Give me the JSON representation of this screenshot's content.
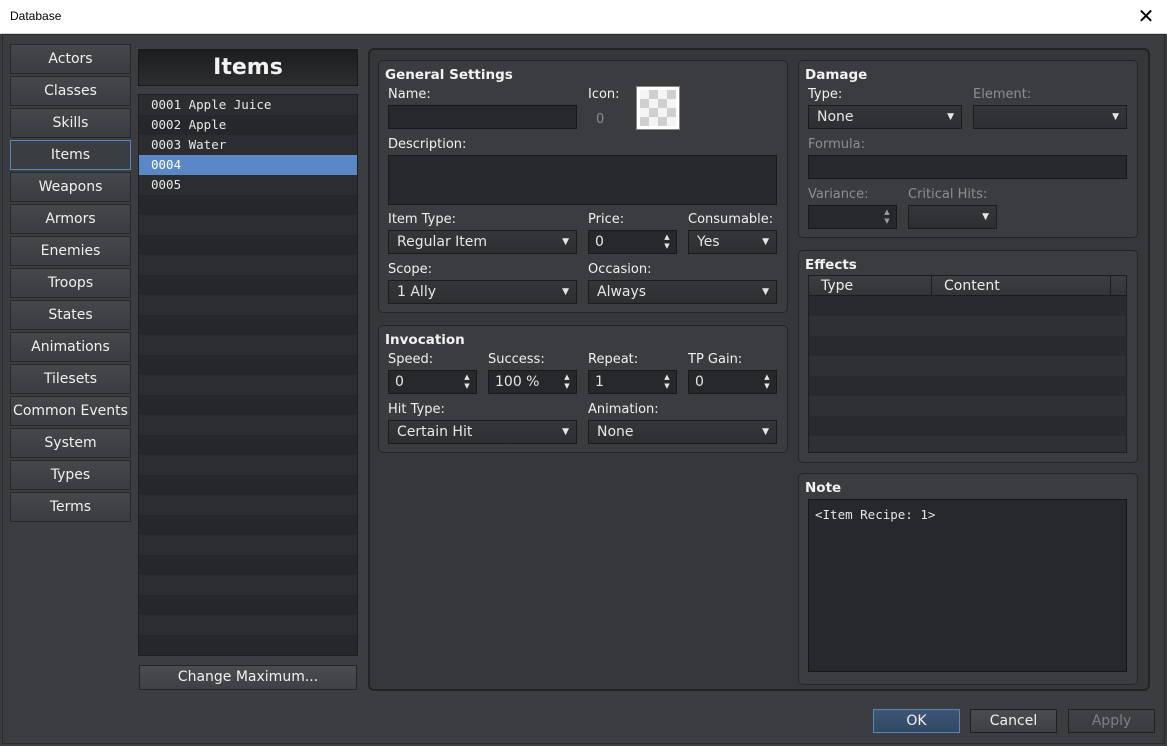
{
  "window": {
    "title": "Database",
    "close_glyph": "✕"
  },
  "categories": [
    "Actors",
    "Classes",
    "Skills",
    "Items",
    "Weapons",
    "Armors",
    "Enemies",
    "Troops",
    "States",
    "Animations",
    "Tilesets",
    "Common Events",
    "System",
    "Types",
    "Terms"
  ],
  "active_category": "Items",
  "items_panel": {
    "title": "Items",
    "rows": [
      "0001 Apple Juice",
      "0002 Apple",
      "0003 Water",
      "0004",
      "0005"
    ],
    "selected_index": 3,
    "change_maximum_label": "Change Maximum..."
  },
  "general": {
    "title": "General Settings",
    "name_label": "Name:",
    "name_value": "",
    "icon_label": "Icon:",
    "icon_index": "0",
    "description_label": "Description:",
    "description_value": "",
    "item_type_label": "Item Type:",
    "item_type_value": "Regular Item",
    "price_label": "Price:",
    "price_value": "0",
    "consumable_label": "Consumable:",
    "consumable_value": "Yes",
    "scope_label": "Scope:",
    "scope_value": "1 Ally",
    "occasion_label": "Occasion:",
    "occasion_value": "Always"
  },
  "invocation": {
    "title": "Invocation",
    "speed_label": "Speed:",
    "speed_value": "0",
    "success_label": "Success:",
    "success_value": "100 %",
    "repeat_label": "Repeat:",
    "repeat_value": "1",
    "tp_gain_label": "TP Gain:",
    "tp_gain_value": "0",
    "hit_type_label": "Hit Type:",
    "hit_type_value": "Certain Hit",
    "animation_label": "Animation:",
    "animation_value": "None"
  },
  "damage": {
    "title": "Damage",
    "type_label": "Type:",
    "type_value": "None",
    "element_label": "Element:",
    "element_value": "",
    "formula_label": "Formula:",
    "formula_value": "",
    "variance_label": "Variance:",
    "variance_value": "",
    "critical_label": "Critical Hits:",
    "critical_value": ""
  },
  "effects": {
    "title": "Effects",
    "col_type": "Type",
    "col_content": "Content"
  },
  "note": {
    "title": "Note",
    "value": "<Item Recipe: 1>"
  },
  "buttons": {
    "ok": "OK",
    "cancel": "Cancel",
    "apply": "Apply"
  },
  "glyphs": {
    "dropdown": "▼",
    "spin_up": "▲",
    "spin_down": "▼"
  },
  "colors": {
    "selection": "#5a87c6",
    "accent_border": "#5c86bb"
  }
}
